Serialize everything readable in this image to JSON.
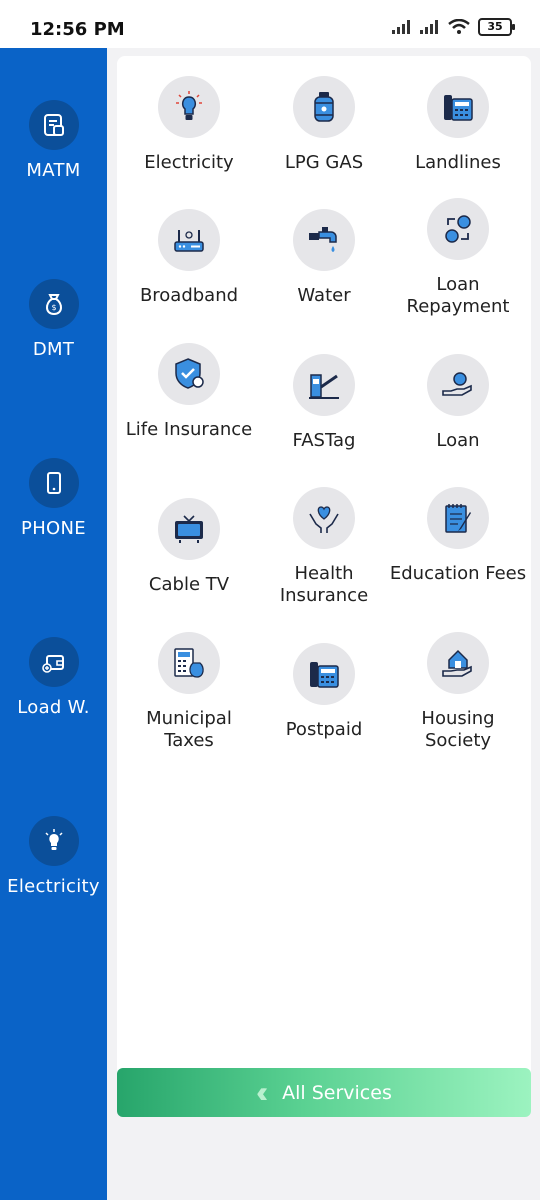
{
  "status_bar": {
    "time": "12:56 PM",
    "battery": "35"
  },
  "sidebar": {
    "items": [
      {
        "label": "MATM",
        "icon": "atm-card-icon"
      },
      {
        "label": "DMT",
        "icon": "money-bag-icon"
      },
      {
        "label": "PHONE",
        "icon": "phone-icon"
      },
      {
        "label": "Load W.",
        "icon": "wallet-icon"
      },
      {
        "label": "Electricity",
        "icon": "bulb-icon"
      }
    ]
  },
  "services": [
    {
      "label": "Electricity",
      "icon": "bulb-icon"
    },
    {
      "label": "LPG GAS",
      "icon": "gas-cylinder-icon"
    },
    {
      "label": "Landlines",
      "icon": "landline-phone-icon"
    },
    {
      "label": "Broadband",
      "icon": "router-icon"
    },
    {
      "label": "Water",
      "icon": "water-tap-icon"
    },
    {
      "label": "Loan Repayment",
      "icon": "coin-exchange-icon"
    },
    {
      "label": "Life Insurance",
      "icon": "shield-check-icon"
    },
    {
      "label": "FASTag",
      "icon": "toll-gate-icon"
    },
    {
      "label": "Loan",
      "icon": "hand-coin-icon"
    },
    {
      "label": "Cable TV",
      "icon": "tv-icon"
    },
    {
      "label": "Health Insurance",
      "icon": "hands-heart-icon"
    },
    {
      "label": "Education Fees",
      "icon": "notepad-pen-icon"
    },
    {
      "label": "Municipal Taxes",
      "icon": "calculator-bag-icon"
    },
    {
      "label": "Postpaid",
      "icon": "desk-phone-icon"
    },
    {
      "label": "Housing Society",
      "icon": "hand-house-icon"
    }
  ],
  "footer": {
    "all_services_label": "All Services"
  },
  "colors": {
    "sidebar": "#0a63c7",
    "icon_circle": "#e6e6e9",
    "accent_green": "#27a56b"
  }
}
